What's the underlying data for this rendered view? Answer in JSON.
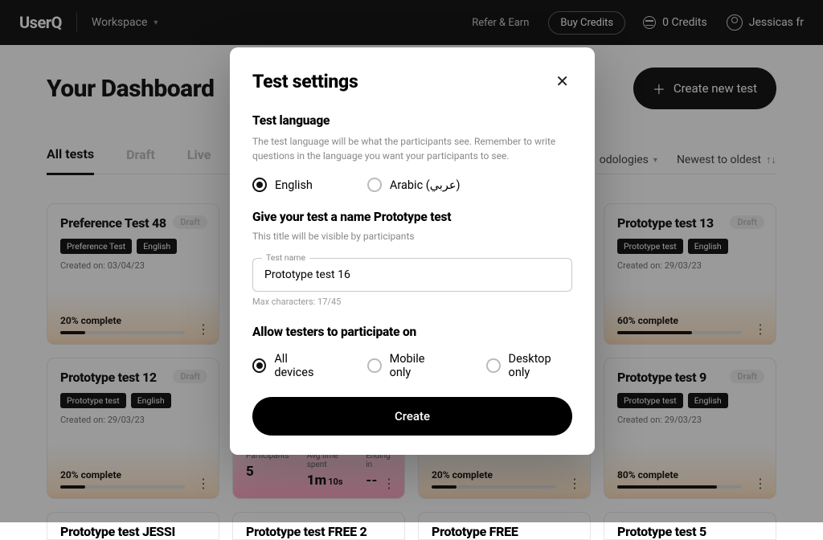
{
  "header": {
    "logo": "UserQ",
    "workspace": "Workspace",
    "refer": "Refer & Earn",
    "buy": "Buy Credits",
    "credits": "0 Credits",
    "user": "Jessicas fr"
  },
  "page": {
    "title": "Your Dashboard",
    "create_btn": "Create new test"
  },
  "tabs": {
    "all": "All tests",
    "draft": "Draft",
    "live": "Live"
  },
  "filters": {
    "methodologies": "odologies",
    "sort": "Newest to oldest"
  },
  "cards": [
    {
      "title": "Preference Test 48",
      "type": "Preference Test",
      "lang": "English",
      "created": "Created on: 03/04/23",
      "pct": "20% complete",
      "pct_val": 20,
      "draft": "Draft"
    },
    {
      "title": "Prototype test 13",
      "type": "Prototype test",
      "lang": "English",
      "created": "Created on: 29/03/23",
      "pct": "60% complete",
      "pct_val": 60,
      "draft": "Draft"
    },
    {
      "title": "Prototype test 12",
      "type": "Prototype test",
      "lang": "English",
      "created": "Created on: 29/03/23",
      "pct": "20% complete",
      "pct_val": 20,
      "draft": "Draft"
    },
    {
      "title": "Prototype test 9",
      "type": "Prototype test",
      "lang": "English",
      "created": "Created on: 29/03/23",
      "pct": "80% complete",
      "pct_val": 80,
      "draft": "Draft"
    }
  ],
  "live_card": {
    "participants_lbl": "Participants",
    "participants_val": "5",
    "avg_lbl": "Avg time spent",
    "avg_val": "1m",
    "avg_sub": "10s",
    "ending_lbl": "Ending in",
    "ending_val": "--"
  },
  "mid_card": {
    "pct": "20% complete",
    "pct_val": 20
  },
  "cut_cards": [
    "Prototype test JESSI",
    "Prototype test FREE 2",
    "Prototype FREE",
    "Prototype test 5"
  ],
  "modal": {
    "title": "Test settings",
    "lang_h": "Test language",
    "lang_help": "The test language will be what the participants see. Remember to write questions in the language you want your participants to see.",
    "lang_en": "English",
    "lang_ar": "Arabic (عربي)",
    "name_h": "Give your test a name Prototype test",
    "name_help": "This title will be visible by participants",
    "field_label": "Test name",
    "field_value": "Prototype test 16",
    "counter": "Max characters: 17/45",
    "devices_h": "Allow testers to participate on",
    "dev_all": "All devices",
    "dev_mobile": "Mobile only",
    "dev_desktop": "Desktop only",
    "create": "Create"
  }
}
